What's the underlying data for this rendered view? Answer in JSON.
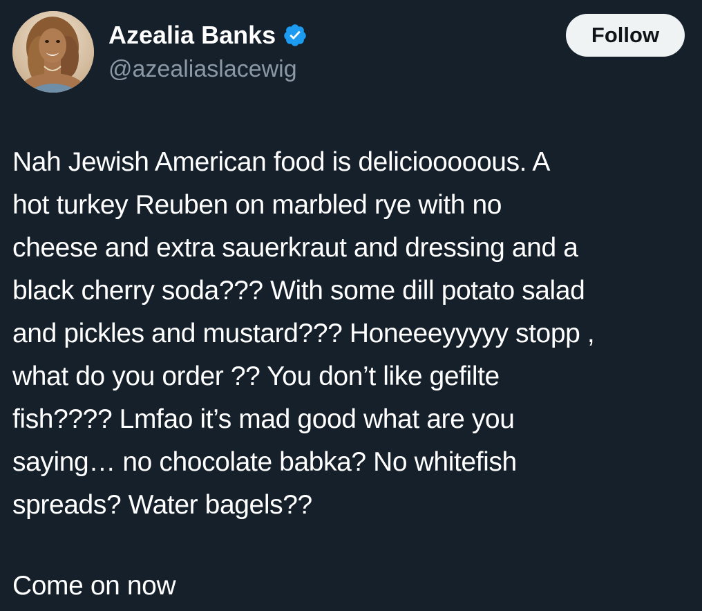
{
  "author": {
    "display_name": "Azealia Banks",
    "handle": "@azealiaslacewig",
    "verified": true,
    "avatar_icon": "profile-photo"
  },
  "follow_button": {
    "label": "Follow"
  },
  "tweet": {
    "lines": [
      "Nah Jewish American food is deliciooooous. A",
      "hot turkey Reuben on marbled rye with no",
      "cheese and extra sauerkraut and dressing and a",
      "black cherry soda??? With some dill potato salad",
      "and pickles and mustard??? Honeeeyyyyy stopp ,",
      "what do you order ?? You don’t like gefilte",
      "fish???? Lmfao it’s mad good what are you",
      "saying… no chocolate babka? No whitefish",
      "spreads? Water bagels??"
    ],
    "closing": "Come on now"
  },
  "colors": {
    "background": "#15202b",
    "text_primary": "#ffffff",
    "text_secondary": "#8b98a5",
    "verified_badge": "#1d9bf0",
    "button_bg": "#eff3f4",
    "button_text": "#0f1419"
  }
}
